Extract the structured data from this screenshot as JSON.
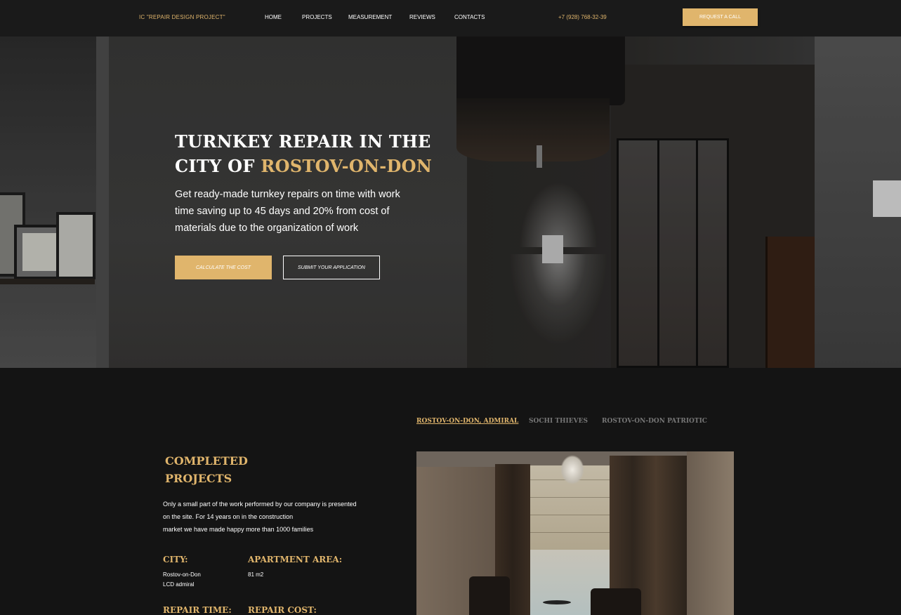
{
  "header": {
    "logo": "IC \"REPAIR DESIGN PROJECT\"",
    "nav": [
      "HOME",
      "PROJECTS",
      "MEASUREMENT",
      "REVIEWS",
      "CONTACTS"
    ],
    "phone": "+7 (928) 768-32-39",
    "cta": "REQUEST A CALL"
  },
  "hero": {
    "title_line1": "TURNKEY REPAIR IN THE",
    "title_prefix": "CITY OF ",
    "title_accent": "ROSTOV-ON-DON",
    "subtitle": "Get ready-made turnkey repairs on time with work time saving up to 45 days and 20% from cost of materials due to the organization of work",
    "btn_primary": "CALCULATE THE COST",
    "btn_secondary": "SUBMIT YOUR APPLICATION"
  },
  "projects": {
    "tabs": [
      "ROSTOV-ON-DON, ADMIRAL",
      "SOCHI THIEVES",
      "ROSTOV-ON-DON PATRIOTIC"
    ],
    "active_tab": 0,
    "title_line1": "COMPLETED",
    "title_line2": "PROJECTS",
    "desc_line1": "Only a small part of the work performed by our company is presented",
    "desc_line2": "on the site. For 14 years on in the construction",
    "desc_line3": "market we have made happy more than 1000 families",
    "city_label": "CITY:",
    "city_value_1": "Rostov-on-Don",
    "city_value_2": "LCD admiral",
    "area_label": "APARTMENT AREA:",
    "area_value": "81 m2",
    "time_label": "REPAIR TIME:",
    "cost_label": "REPAIR COST:"
  },
  "colors": {
    "accent": "#e0b56c",
    "background": "#141414",
    "header": "#1a1a1a"
  }
}
